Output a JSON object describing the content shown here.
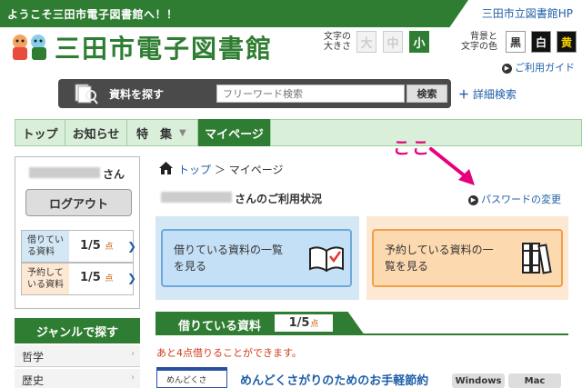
{
  "header": {
    "welcome": "ようこそ三田市電子図書館へ！！",
    "hp_link": "三田市立図書館HP",
    "site_title": "三田市電子図書館",
    "font_size_label_1": "文字の",
    "font_size_label_2": "大きさ",
    "font_sizes": [
      "大",
      "中",
      "小"
    ],
    "font_size_selected": "小",
    "bg_label_1": "背景と",
    "bg_label_2": "文字の色",
    "bg_options": [
      "黒",
      "白",
      "黄"
    ],
    "guide": "ご利用ガイド"
  },
  "search": {
    "label": "資料を探す",
    "placeholder": "フリーワード検索",
    "button": "検索",
    "advanced": "詳細検索"
  },
  "nav": {
    "items": [
      "トップ",
      "お知らせ",
      "特　集",
      "マイページ"
    ],
    "active": "マイページ"
  },
  "sidebar": {
    "user_suffix": "さん",
    "logout": "ログアウト",
    "borrowed_label": "借りている資料",
    "borrowed_value": "1/5",
    "reserved_label": "予約している資料",
    "reserved_value": "1/5",
    "unit": "点",
    "genre_heading": "ジャンルで探す",
    "genres": [
      "哲学",
      "歴史"
    ]
  },
  "main": {
    "breadcrumb_home": "トップ",
    "breadcrumb_sep": "＞",
    "breadcrumb_current": "マイページ",
    "usage_suffix": "さんのご利用状況",
    "password_link": "パスワードの変更",
    "annotation": "ここ",
    "card_borrowed_line1": "借りている資料の一覧",
    "card_borrowed_line2": "を見る",
    "card_reserved_line1": "予約している資料の一",
    "card_reserved_line2": "覧を見る",
    "borrow_section_label": "借りている資料",
    "borrow_section_count": "1/5",
    "borrow_section_unit": "点",
    "remaining_msg": "あと4点借りることができます。",
    "book_thumb_text": "めんどくさ",
    "book_title": "めんどくさがりのためのお手軽節約",
    "platform_tags": [
      "Windows",
      "Mac"
    ]
  },
  "colors": {
    "brand_green": "#2e7d32",
    "link_blue": "#1f5fa8",
    "annotation_pink": "#e6007e"
  }
}
